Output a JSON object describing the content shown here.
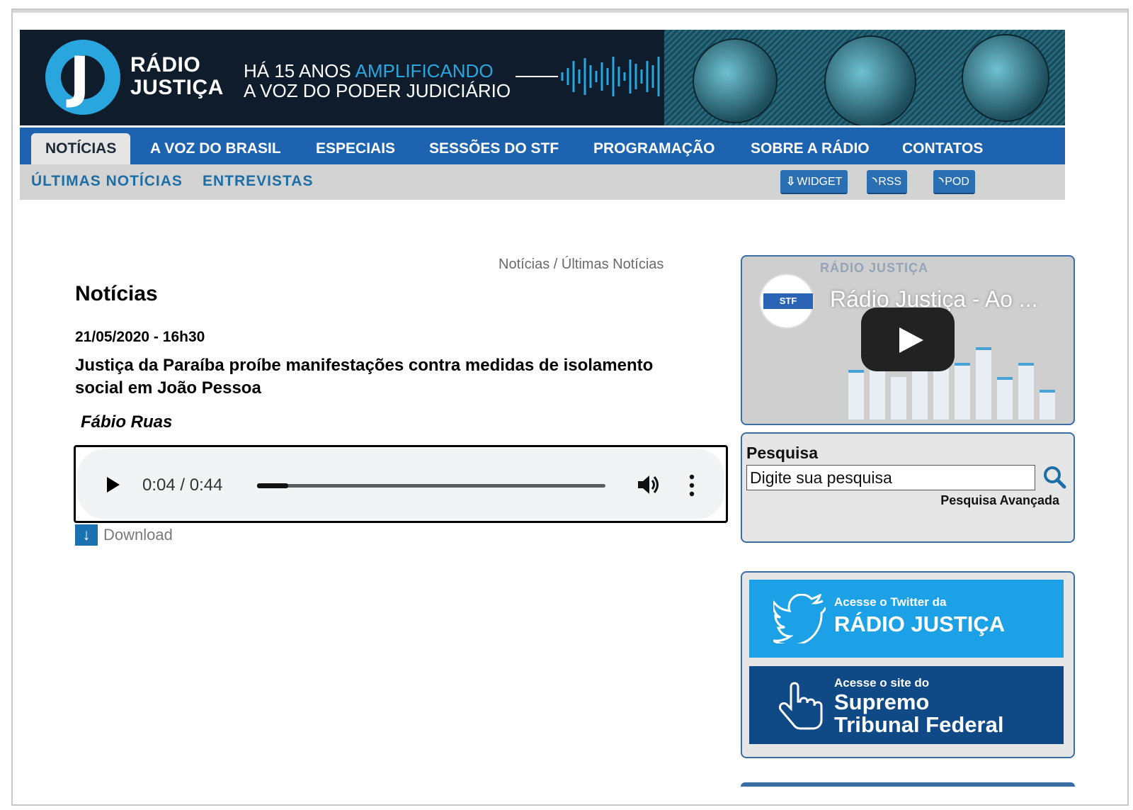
{
  "banner": {
    "brand_line1": "RÁDIO",
    "brand_line2": "JUSTIÇA",
    "tagline_prefix": "HÁ 15 ANOS ",
    "tagline_accent": "AMPLIFICANDO",
    "tagline_line2": "A VOZ DO PODER JUDICIÁRIO"
  },
  "nav": {
    "items": [
      {
        "label": "NOTÍCIAS",
        "active": true
      },
      {
        "label": "A VOZ DO BRASIL"
      },
      {
        "label": "ESPECIAIS"
      },
      {
        "label": "SESSÕES DO STF"
      },
      {
        "label": "PROGRAMAÇÃO"
      },
      {
        "label": "SOBRE A RÁDIO"
      },
      {
        "label": "CONTATOS"
      }
    ]
  },
  "subnav": {
    "links": [
      "ÚLTIMAS NOTÍCIAS",
      "ENTREVISTAS"
    ],
    "buttons": [
      "WIDGET",
      "RSS",
      "POD"
    ]
  },
  "breadcrumb": {
    "root": "Notícias",
    "separator": " / ",
    "current": "Últimas Notícias"
  },
  "article": {
    "section_title": "Notícias",
    "date": "21/05/2020 - 16h30",
    "headline": "Justiça da Paraíba proíbe manifestações contra medidas de isolamento social em João Pessoa",
    "author": "Fábio Ruas",
    "audio": {
      "time": "0:04 / 0:44",
      "progress": 0.09
    },
    "download_label": "Download"
  },
  "sidebar": {
    "video": {
      "channel_label": "RÁDIO JUSTIÇA",
      "logo_text": "STF",
      "title": "Rádio Justiça - Ao ..."
    },
    "search": {
      "label": "Pesquisa",
      "placeholder": "Digite sua pesquisa",
      "advanced": "Pesquisa Avançada"
    },
    "twitter": {
      "small": "Acesse o Twitter da",
      "big": "RÁDIO JUSTIÇA"
    },
    "stf": {
      "small": "Acesse o site do",
      "big_line1": "Supremo",
      "big_line2": "Tribunal Federal"
    }
  },
  "colors": {
    "nav": "#1e63b0",
    "accent": "#2aa6de",
    "banner": "#0e1c2c",
    "twitter": "#1da1e6",
    "stf": "#0f4a87"
  }
}
